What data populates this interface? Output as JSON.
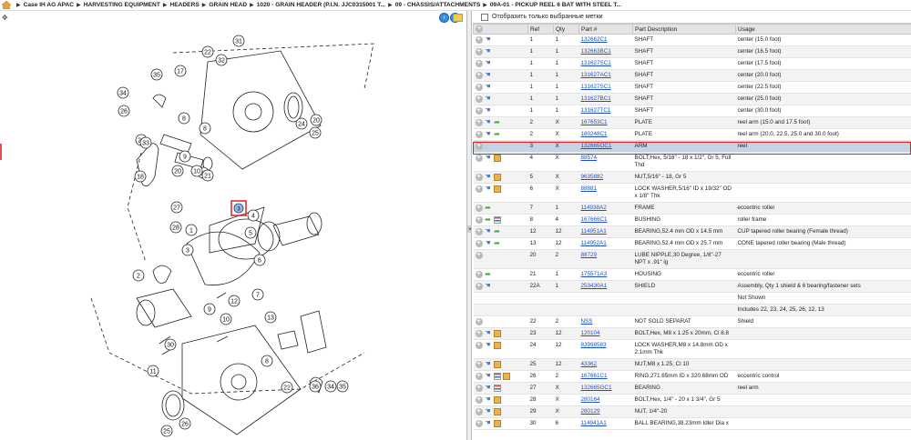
{
  "breadcrumb": [
    "Case IH AG APAC",
    "HARVESTING EQUIPMENT",
    "HEADERS",
    "GRAIN HEAD",
    "1020 - GRAIN HEADER (P.I.N. JJC0315001 T...",
    "09 - CHASSIS/ATTACHMENTS",
    "09A-01 - PICKUP REEL 6 BAT WITH STEEL T..."
  ],
  "filter": {
    "label": "Отобразить только выбранные метки"
  },
  "columns": {
    "ref": "Ref",
    "qty": "Qty",
    "part": "Part #",
    "desc": "Part Description",
    "usage": "Usage"
  },
  "diagram": {
    "callouts": [
      "31",
      "22",
      "32",
      "17",
      "35",
      "34",
      "26",
      "23",
      "24",
      "25",
      "20",
      "8",
      "33",
      "20",
      "29",
      "8",
      "9",
      "21",
      "18",
      "10",
      "27",
      "28",
      "3",
      "4",
      "5",
      "6",
      "2",
      "1",
      "7",
      "12",
      "13",
      "9",
      "8",
      "36",
      "34",
      "35",
      "11",
      "30",
      "10",
      "22",
      "25",
      "26"
    ]
  },
  "colors": {
    "selection": "#c5d3e4",
    "highlight_border": "#d22222",
    "link": "#1a4fd0"
  },
  "rows": [
    {
      "icons": [
        "plus",
        "hand"
      ],
      "ref": "1",
      "qty": "1",
      "part": "132662C1",
      "desc": "SHAFT",
      "usage": "center (15.0 foot)"
    },
    {
      "icons": [
        "plus",
        "hand"
      ],
      "ref": "1",
      "qty": "1",
      "part": "132663BC1",
      "desc": "SHAFT",
      "usage": "center (16.5 foot)"
    },
    {
      "icons": [
        "plus",
        "hand"
      ],
      "ref": "1",
      "qty": "1",
      "part": "131627SC1",
      "desc": "SHAFT",
      "usage": "center (17.5 foot)"
    },
    {
      "icons": [
        "plus",
        "hand"
      ],
      "ref": "1",
      "qty": "1",
      "part": "131627AC1",
      "desc": "SHAFT",
      "usage": "center (20.0 foot)"
    },
    {
      "icons": [
        "plus",
        "hand"
      ],
      "ref": "1",
      "qty": "1",
      "part": "131627SC1",
      "desc": "SHAFT",
      "usage": "center (22.5 foot)"
    },
    {
      "icons": [
        "plus",
        "hand"
      ],
      "ref": "1",
      "qty": "1",
      "part": "131627BC1",
      "desc": "SHAFT",
      "usage": "center (25.0 foot)"
    },
    {
      "icons": [
        "plus",
        "hand"
      ],
      "ref": "1",
      "qty": "1",
      "part": "131627TC1",
      "desc": "SHAFT",
      "usage": "center (30.0 foot)"
    },
    {
      "icons": [
        "plus",
        "hand",
        "arrow"
      ],
      "ref": "2",
      "qty": "X",
      "part": "167653C1",
      "desc": "PLATE",
      "usage": "reel arm (15.0 and 17.5 foot)"
    },
    {
      "icons": [
        "plus",
        "hand",
        "arrow"
      ],
      "ref": "2",
      "qty": "X",
      "part": "180248C1",
      "desc": "PLATE",
      "usage": "reel arm (20.0, 22.5, 25.0 and 30.0 foot)"
    },
    {
      "icons": [
        "plus"
      ],
      "ref": "3",
      "qty": "X",
      "part": "132665OC1",
      "desc": "ARM",
      "usage": "reel",
      "selected": true
    },
    {
      "icons": [
        "plus",
        "hand",
        "box"
      ],
      "ref": "4",
      "qty": "X",
      "part": "88574",
      "desc": "BOLT,Hex, 5/16\" - 18 x 1/2\", Gr 5, Full Thd",
      "usage": ""
    },
    {
      "icons": [
        "plus",
        "hand",
        "box"
      ],
      "ref": "5",
      "qty": "X",
      "part": "9635882",
      "desc": "NUT,5/16\" - 18, Gr 5",
      "usage": ""
    },
    {
      "icons": [
        "plus",
        "hand",
        "box"
      ],
      "ref": "6",
      "qty": "X",
      "part": "88881",
      "desc": "LOCK WASHER,5/16\" ID x 19/32\" OD x 1/8\" Thk",
      "usage": ""
    },
    {
      "icons": [
        "plus",
        "arrow"
      ],
      "ref": "7",
      "qty": "1",
      "part": "114938A2",
      "desc": "FRAME",
      "usage": "eccentric roller"
    },
    {
      "icons": [
        "plus",
        "arrow",
        "stack"
      ],
      "ref": "8",
      "qty": "4",
      "part": "167666C1",
      "desc": "BUSHING",
      "usage": "roller frame"
    },
    {
      "icons": [
        "plus",
        "hand",
        "arrow"
      ],
      "ref": "12",
      "qty": "12",
      "part": "114951A1",
      "desc": "BEARING,52.4 mm OD x 14.5 mm",
      "usage": "CUP tapered roller bearing (Female thread)"
    },
    {
      "icons": [
        "plus",
        "hand",
        "arrow"
      ],
      "ref": "13",
      "qty": "12",
      "part": "114952A1",
      "desc": "BEARING,52.4 mm OD x 25.7 mm",
      "usage": "CONE tapered roller bearing (Male thread)"
    },
    {
      "icons": [
        "plus"
      ],
      "ref": "20",
      "qty": "2",
      "part": "88729",
      "desc": "LUBE NIPPLE,30 Degree, 1/8\"-27 NPT x .91\" lg",
      "usage": ""
    },
    {
      "icons": [
        "plus",
        "arrow"
      ],
      "ref": "21",
      "qty": "1",
      "part": "175571A3",
      "desc": "HOUSING",
      "usage": "eccentric roller"
    },
    {
      "icons": [
        "plus",
        "hand"
      ],
      "ref": "22A",
      "qty": "1",
      "part": "253430A1",
      "desc": "SHIELD",
      "usage": "Assembly, Qty 1 shield & 6 bearing/fastener sets"
    },
    {
      "icons": [],
      "ref": "",
      "qty": "",
      "part": "",
      "desc": "",
      "usage": "Not Shown"
    },
    {
      "icons": [],
      "ref": "",
      "qty": "",
      "part": "",
      "desc": "",
      "usage": "Includes 22, 23, 24, 25, 26, 12, 13"
    },
    {
      "icons": [
        "plus"
      ],
      "ref": "22",
      "qty": "2",
      "part": "NSS",
      "desc": "NOT SOLD SEPARAT",
      "usage": "Shield"
    },
    {
      "icons": [
        "plus",
        "hand",
        "box"
      ],
      "ref": "23",
      "qty": "12",
      "part": "120104",
      "desc": "BOLT,Hex, M8 x 1.25 x 20mm, Cl 8.8",
      "usage": ""
    },
    {
      "icons": [
        "plus",
        "hand",
        "box"
      ],
      "ref": "24",
      "qty": "12",
      "part": "83998583",
      "desc": "LOCK WASHER,M8 x 14.8mm OD x 2.1mm Thk",
      "usage": ""
    },
    {
      "icons": [
        "plus",
        "hand",
        "box"
      ],
      "ref": "25",
      "qty": "12",
      "part": "43362",
      "desc": "NUT,M8 x 1.25, Cl 10",
      "usage": ""
    },
    {
      "icons": [
        "plus",
        "hand",
        "stack",
        "box"
      ],
      "ref": "26",
      "qty": "2",
      "part": "167661C1",
      "desc": "RING,271.65mm ID x 320.68mm OD",
      "usage": "eccentric control"
    },
    {
      "icons": [
        "plus",
        "hand",
        "stack"
      ],
      "ref": "27",
      "qty": "X",
      "part": "132665GC1",
      "desc": "BEARING",
      "usage": "reel arm"
    },
    {
      "icons": [
        "plus",
        "hand",
        "box"
      ],
      "ref": "28",
      "qty": "X",
      "part": "280164",
      "desc": "BOLT,Hex, 1/4\" - 20 x 1 3/4\", Gr 5",
      "usage": ""
    },
    {
      "icons": [
        "plus",
        "hand",
        "box"
      ],
      "ref": "29",
      "qty": "X",
      "part": "280129",
      "desc": "NUT, 1/4\"-20",
      "usage": ""
    },
    {
      "icons": [
        "plus",
        "hand",
        "box"
      ],
      "ref": "30",
      "qty": "6",
      "part": "114941A1",
      "desc": "BALL BEARING,38.23mm Idler Dia x",
      "usage": ""
    }
  ]
}
